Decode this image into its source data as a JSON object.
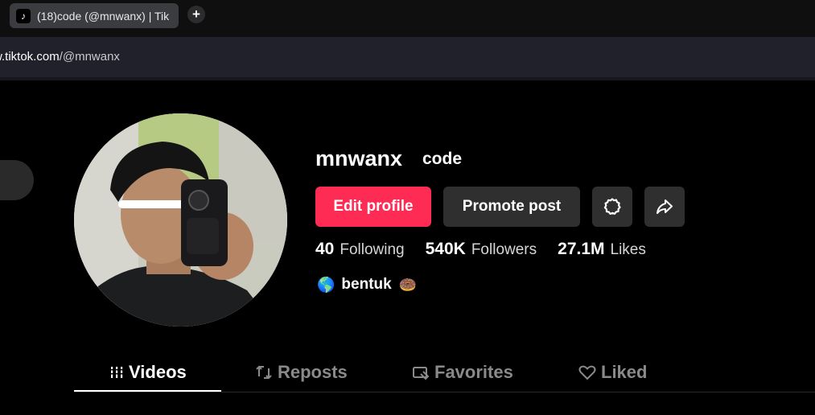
{
  "browser": {
    "tab_title": "(18)code (@mnwanx) | Tik",
    "url_domain": "w.tiktok.com",
    "url_path": "/@mnwanx"
  },
  "profile": {
    "username": "mnwanx",
    "nickname": "code",
    "buttons": {
      "edit": "Edit profile",
      "promote": "Promote post"
    },
    "stats": [
      {
        "num": "40",
        "label": "Following"
      },
      {
        "num": "540K",
        "label": "Followers"
      },
      {
        "num": "27.1M",
        "label": "Likes"
      }
    ],
    "bio": {
      "text": "bentuk",
      "lead_icon": "globe-icon",
      "trail_icon": "donut-icon"
    }
  },
  "tabs": [
    {
      "label": "Videos",
      "icon": "grid-lines-icon",
      "active": true
    },
    {
      "label": "Reposts",
      "icon": "repost-icon",
      "active": false
    },
    {
      "label": "Favorites",
      "icon": "bookmark-icon",
      "active": false
    },
    {
      "label": "Liked",
      "icon": "heart-icon",
      "active": false
    }
  ],
  "colors": {
    "accent": "#fe2c55",
    "background": "#000000",
    "button_dark": "#2f2f2f"
  }
}
